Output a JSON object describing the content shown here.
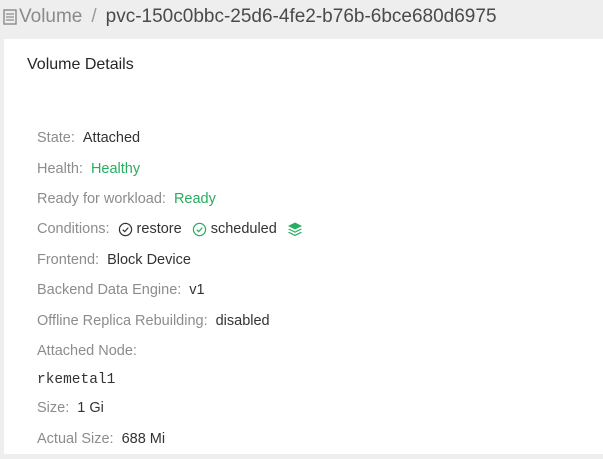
{
  "breadcrumb": {
    "root": "Volume",
    "separator": "/",
    "name": "pvc-150c0bbc-25d6-4fe2-b76b-6bce680d6975"
  },
  "panel": {
    "title": "Volume Details"
  },
  "details": {
    "state": {
      "label": "State:",
      "value": "Attached"
    },
    "health": {
      "label": "Health:",
      "value": "Healthy"
    },
    "ready": {
      "label": "Ready for workload:",
      "value": "Ready"
    },
    "conditions": {
      "label": "Conditions:",
      "items": [
        "restore",
        "scheduled"
      ],
      "extra_icon": "layers-icon"
    },
    "frontend": {
      "label": "Frontend:",
      "value": "Block Device"
    },
    "backend": {
      "label": "Backend Data Engine:",
      "value": "v1"
    },
    "offline_rebuild": {
      "label": "Offline Replica Rebuilding:",
      "value": "disabled"
    },
    "node": {
      "label": "Attached Node:",
      "value": "rkemetal1"
    },
    "size": {
      "label": "Size:",
      "value": "1 Gi"
    },
    "actual_size": {
      "label": "Actual Size:",
      "value": "688 Mi"
    }
  },
  "colors": {
    "healthy": "#27ae60",
    "label": "#8c8c8c",
    "value": "#333333"
  }
}
